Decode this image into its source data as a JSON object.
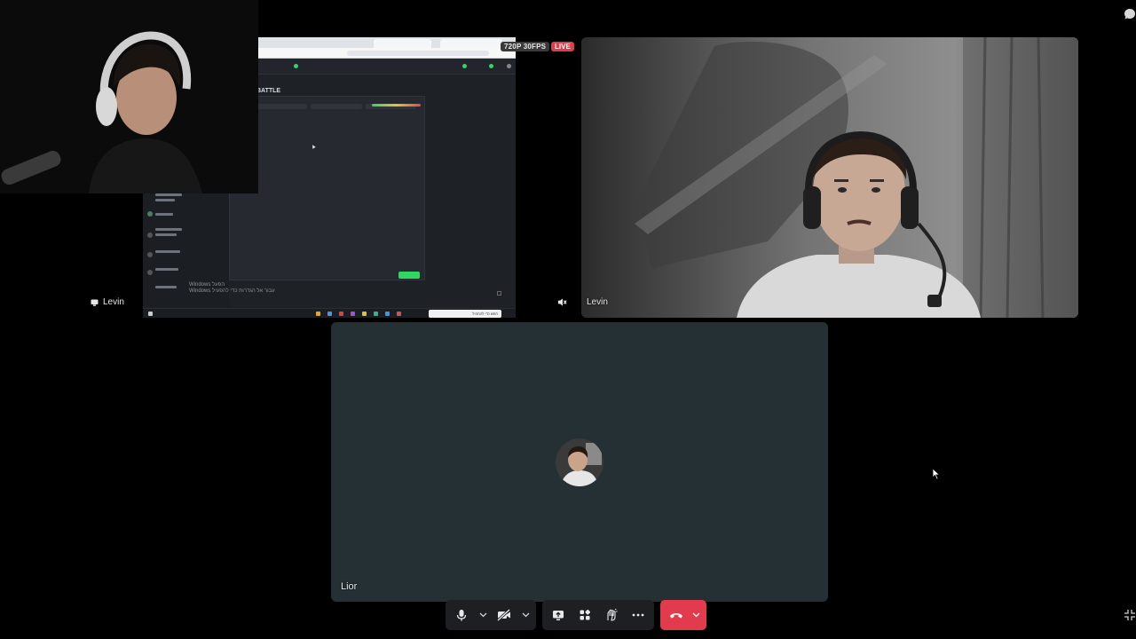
{
  "participants": {
    "screen_share": {
      "name": "Levin",
      "title_text": "BATTLE",
      "watermark": [
        "Windows הפעל",
        "Windows עבור אל הגדרות כדי להפעיל"
      ],
      "taskbar_search": "חפש כדי להתחיל"
    },
    "camera_right": {
      "name": "Levin",
      "muted": true
    },
    "bottom": {
      "name": "Lior"
    }
  },
  "stream_badges": {
    "quality": "720P 30FPS",
    "live": "LIVE"
  },
  "controls": {
    "mic_icon": "microphone-icon",
    "camera_icon": "camera-off-icon",
    "share_icon": "screen-share-icon",
    "activities_icon": "activities-icon",
    "soundboard_icon": "soundboard-icon",
    "more_icon": "more-icon",
    "hangup_icon": "hangup-icon"
  },
  "colors": {
    "live": "#e03c4a",
    "hangup": "#e23b4d",
    "tile_bg": "#253035",
    "green": "#2fd664"
  }
}
